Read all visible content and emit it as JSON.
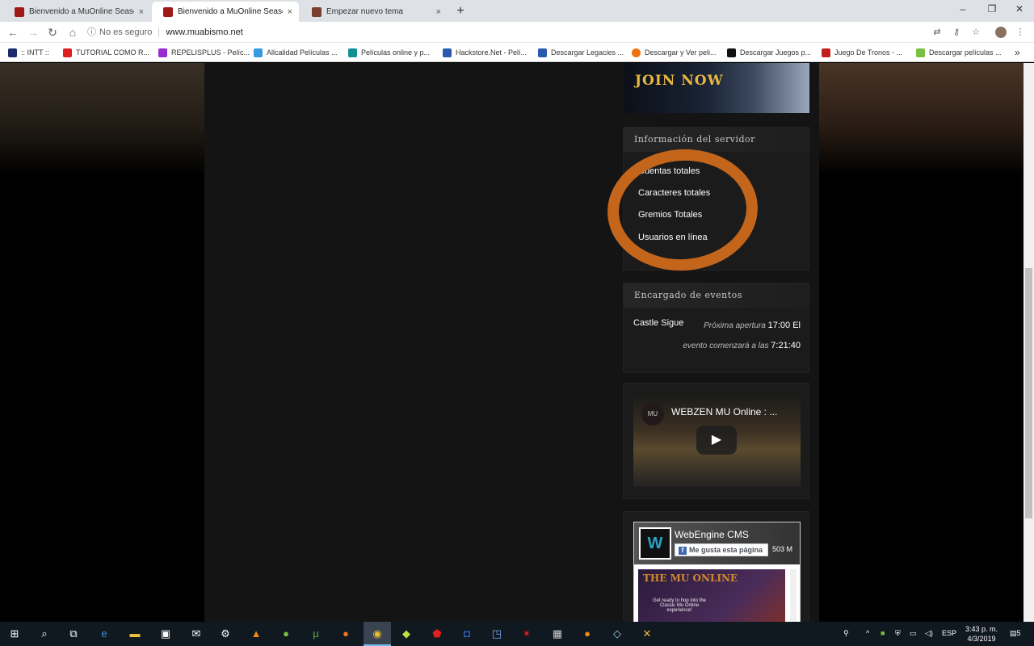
{
  "tabs": [
    {
      "title": "Bienvenido a MuOnline Season 3",
      "close": "×"
    },
    {
      "title": "Bienvenido a MuOnline Season 3",
      "close": "×"
    },
    {
      "title": "Empezar nuevo tema",
      "close": "×"
    }
  ],
  "new_tab": "+",
  "window_controls": [
    "–",
    "❐",
    "✕"
  ],
  "address": {
    "security": "No es seguro",
    "url": "www.muabismo.net"
  },
  "bookmarks": [
    ":: INTT ::",
    "TUTORIAL COMO R...",
    "REPELISPLUS - Pelíc...",
    "Allcalidad Películas ...",
    "Películas online y p...",
    "Hackstore.Net - Pelí...",
    "Descargar Legacies ...",
    "Descargar y Ver peli...",
    "Descargar Juegos p...",
    "Juego De Tronos - ...",
    "Descargar películas ..."
  ],
  "banner": {
    "text": "JOIN NOW"
  },
  "server_info": {
    "title": "Información del servidor",
    "items": [
      "Cuentas totales",
      "Caracteres totales",
      "Gremios Totales",
      "Usuarios en línea"
    ]
  },
  "events": {
    "title": "Encargado de eventos",
    "name": "Castle Sigue",
    "next_label": "Próxima apertura",
    "next_value": "17:00 El",
    "start_label": "evento comenzará a las",
    "start_value": "7:21:40"
  },
  "video": {
    "logo": "MU",
    "title": "WEBZEN MU Online : ...",
    "play": "▶"
  },
  "facebook": {
    "page_name": "WebEngine CMS",
    "logo": "W",
    "like_label": "Me gusta esta página",
    "like_count": "503 M",
    "image_title": "THE MU ONLINE",
    "image_text": "Get ready to hop into the Classic Mu Online experience!"
  },
  "taskbar": {
    "lang": "ESP",
    "time": "3:43 p. m.",
    "date": "4/3/2019",
    "notifications": "5"
  },
  "colors": {
    "annotation": "#c4651c",
    "taskbar": "#101820",
    "tab_active": "#ffffff"
  }
}
